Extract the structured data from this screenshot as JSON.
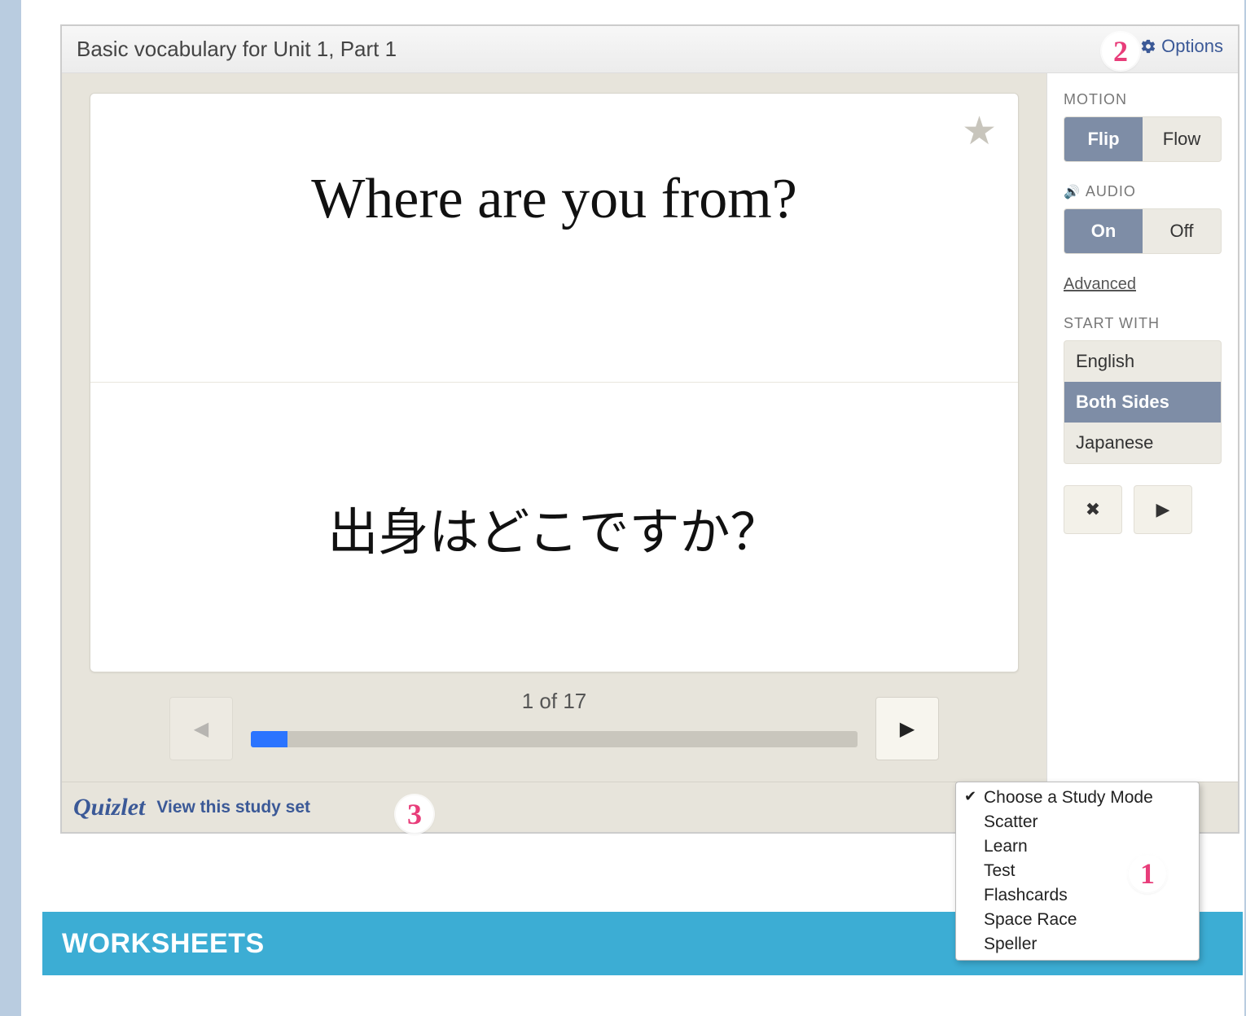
{
  "header": {
    "title": "Basic vocabulary for Unit 1, Part 1",
    "options_label": "Options"
  },
  "card": {
    "front": "Where are you from?",
    "back": "出身はどこですか？",
    "progress_label": "1 of 17",
    "progress_current": 1,
    "progress_total": 17
  },
  "footer": {
    "brand": "Quizlet",
    "view_link": "View this study set"
  },
  "side": {
    "motion": {
      "label": "MOTION",
      "option_a": "Flip",
      "option_b": "Flow"
    },
    "audio": {
      "label": "AUDIO",
      "option_a": "On",
      "option_b": "Off"
    },
    "advanced": "Advanced",
    "startwith": {
      "label": "START WITH",
      "options": [
        "English",
        "Both Sides",
        "Japanese"
      ],
      "selected_index": 1
    }
  },
  "dropdown": {
    "items": [
      "Choose a Study Mode",
      "Scatter",
      "Learn",
      "Test",
      "Flashcards",
      "Space Race",
      "Speller"
    ],
    "checked_index": 0
  },
  "worksheets": {
    "title": "WORKSHEETS"
  },
  "annotations": {
    "a1": "1",
    "a2": "2",
    "a3": "3"
  }
}
